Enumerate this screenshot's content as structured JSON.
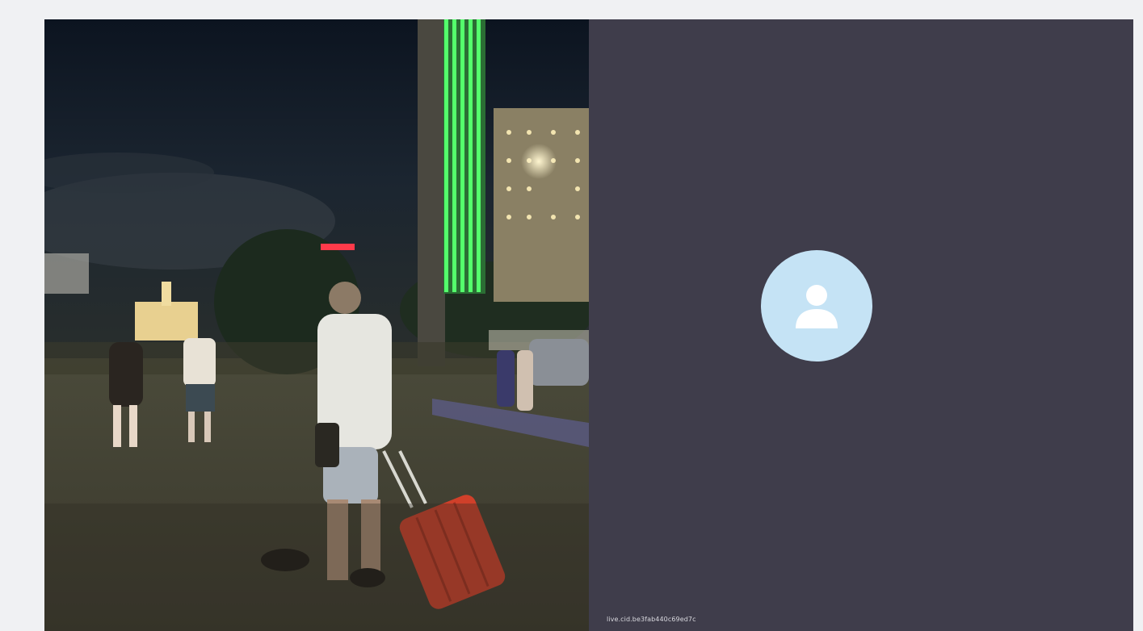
{
  "tiles": [
    {
      "kind": "video",
      "description_icon": "camera-feed"
    },
    {
      "kind": "avatar-placeholder",
      "avatar_icon": "person-icon",
      "participant_id": "live.cid.be3fab440c69ed7c"
    }
  ],
  "colors": {
    "page_background": "#f0f1f3",
    "placeholder_background": "#3f3d4b",
    "avatar_circle": "#c5e3f5",
    "avatar_glyph": "#ffffff"
  }
}
